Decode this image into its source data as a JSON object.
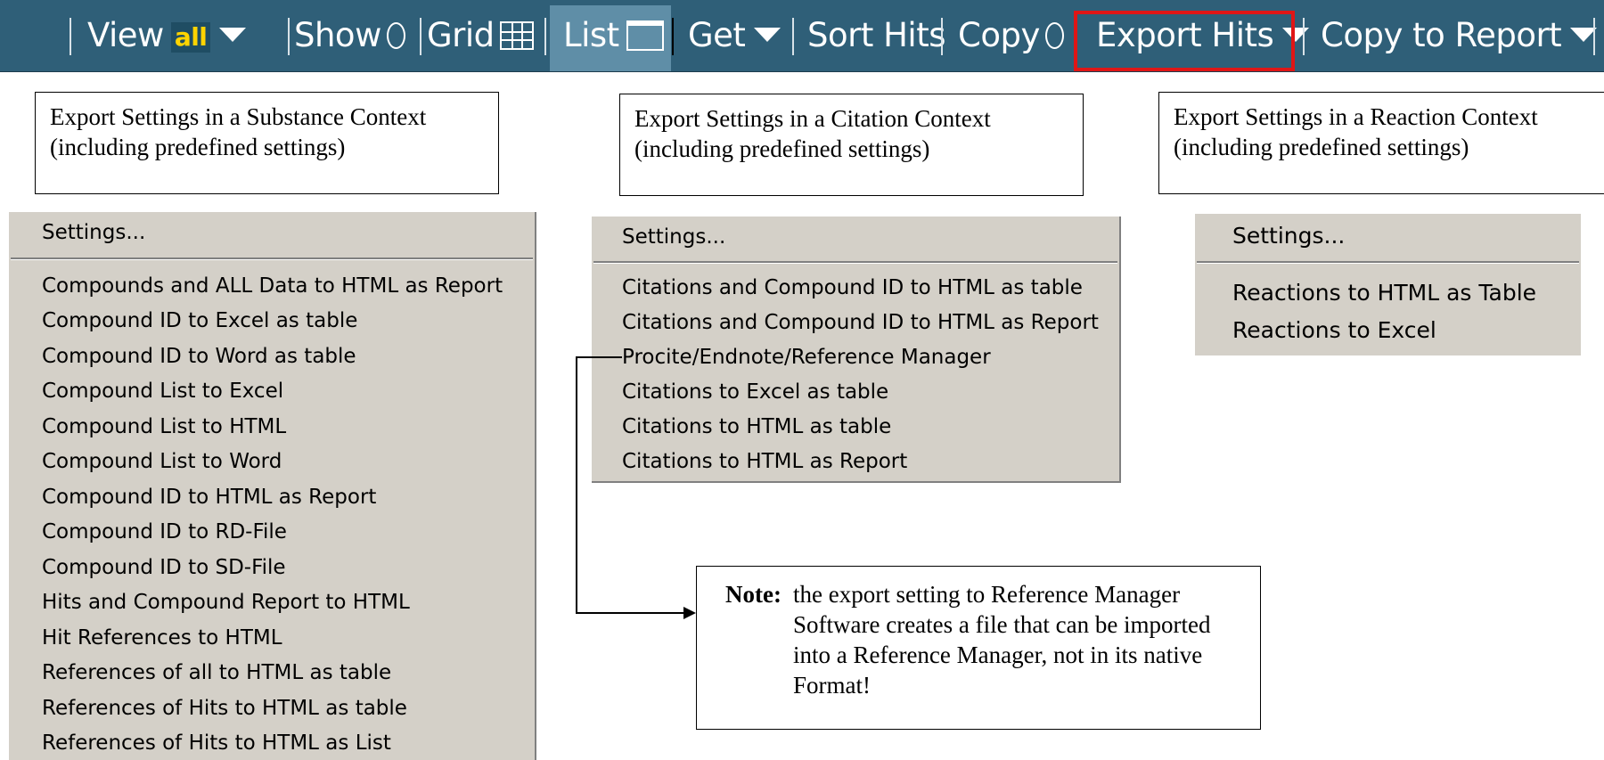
{
  "toolbar": {
    "view_label": "View",
    "view_badge": "all",
    "show_label": "Show",
    "grid_label": "Grid",
    "list_label": "List",
    "get_label": "Get",
    "sort_label": "Sort Hits",
    "copy_label": "Copy",
    "export_label": "Export Hits",
    "copy_report_label": "Copy to Report",
    "highlight_color": "#e01616",
    "background_color": "#2f5f78"
  },
  "captions": {
    "substance": "Export Settings in a Substance Context (including predefined settings)",
    "citation": "Export Settings in a Citation Context (including predefined settings)",
    "reaction": "Export Settings in a Reaction Context (including predefined settings)"
  },
  "menus": {
    "substance": {
      "settings": "Settings...",
      "items": [
        "Compounds and ALL Data to HTML as Report",
        "Compound ID to Excel as table",
        "Compound ID to Word as table",
        "Compound List to Excel",
        "Compound List to HTML",
        "Compound List to Word",
        "Compound ID to HTML as Report",
        "Compound ID to RD-File",
        "Compound ID to SD-File",
        "Hits and Compound Report to HTML",
        "Hit References to HTML",
        "References of all to HTML as table",
        "References of Hits to HTML as table",
        "References of Hits to HTML as List"
      ]
    },
    "citation": {
      "settings": "Settings...",
      "items": [
        "Citations and Compound ID to HTML as table",
        "Citations and Compound ID to HTML as Report",
        "Procite/Endnote/Reference Manager",
        "Citations to Excel as table",
        "Citations to HTML as table",
        "Citations to HTML as Report"
      ]
    },
    "reaction": {
      "settings": "Settings...",
      "items": [
        "Reactions to HTML as Table",
        "Reactions to Excel"
      ]
    }
  },
  "note": {
    "label": "Note:",
    "text": "the export setting to Reference Manager Software creates a file that can be imported into a Reference Manager, not in its native Format!"
  }
}
